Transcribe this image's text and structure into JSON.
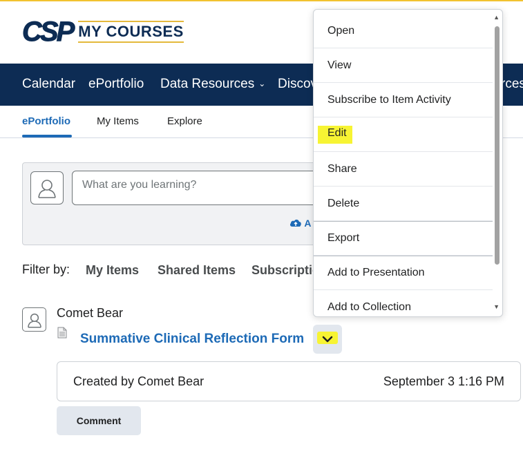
{
  "logo": {
    "mark": "CSP",
    "text": "MY COURSES"
  },
  "navbar": {
    "items": [
      {
        "label": "Calendar"
      },
      {
        "label": "ePortfolio"
      },
      {
        "label": "Data Resources",
        "has_dropdown": true
      },
      {
        "label": "Discov"
      },
      {
        "label": "rces"
      }
    ]
  },
  "tabs": [
    {
      "label": "ePortfolio",
      "active": true
    },
    {
      "label": "My Items"
    },
    {
      "label": "Explore"
    }
  ],
  "composer": {
    "placeholder": "What are you learning?",
    "add_label": "A"
  },
  "filter": {
    "label": "Filter by:",
    "options": [
      "My Items",
      "Shared Items",
      "Subscriptio"
    ]
  },
  "item": {
    "author": "Comet Bear",
    "title": "Summative Clinical Reflection Form",
    "created": "Created by Comet Bear",
    "date": "September 3 1:16 PM",
    "comment_label": "Comment"
  },
  "menu": {
    "items": [
      {
        "label": "Open"
      },
      {
        "label": "View"
      },
      {
        "label": "Subscribe to Item Activity"
      },
      {
        "label": "Edit",
        "highlighted": true
      },
      {
        "label": "Share"
      },
      {
        "label": "Delete"
      },
      {
        "label": "Export"
      },
      {
        "label": "Add to Presentation"
      },
      {
        "label": "Add to Collection"
      }
    ]
  },
  "colors": {
    "navy": "#0d2c54",
    "link_blue": "#1d6ab6",
    "gold": "#e4b93b",
    "highlight": "#f7f433"
  }
}
